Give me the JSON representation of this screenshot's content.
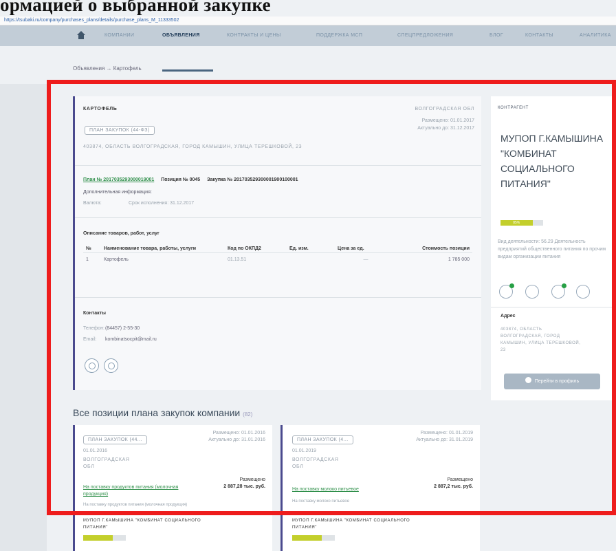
{
  "overlay": {
    "title": "ормацией о выбранной закупке"
  },
  "browser": {
    "url": "https://tsubaki.ru/company/purchases_plans/details/purchase_plans_M_11333502"
  },
  "nav": {
    "items": [
      "КОМПАНИИ",
      "ОБЪЯВЛЕНИЯ",
      "КОНТРАКТЫ И ЦЕНЫ",
      "ПОДДЕРЖКА МСП",
      "СПЕЦПРЕДЛОЖЕНИЯ",
      "БЛОГ",
      "КОНТАКТЫ",
      "АНАЛИТИКА"
    ],
    "active": "ОБЪЯВЛЕНИЯ"
  },
  "breadcrumb": {
    "text": "Объявления → Картофель"
  },
  "announcement": {
    "title": "КАРТОФЕЛЬ",
    "region": "ВОЛГОГРАДСКАЯ ОБЛ",
    "tag": "ПЛАН ЗАКУПОК (44-ФЗ)",
    "placed": "Размещено: 01.01.2017",
    "actual": "Актуально до: 31.12.2017",
    "address": "403874, ОБЛАСТЬ ВОЛГОГРАДСКАЯ, ГОРОД КАМЫШИН, УЛИЦА ТЕРЕШКОВОЙ, 23",
    "plan_link": "План № 2017035293000019001",
    "position": "Позиция № 0045",
    "purchase": "Закупка № 201703529300001900100001",
    "extra_info": "Дополнительная информация:",
    "currency_label": "Валюта:",
    "deadline": "Срок исполнения: 31.12.2017",
    "goods_title": "Описание товаров, работ, услуг",
    "table": {
      "headers": [
        "№",
        "Наименование товара, работы, услуги",
        "Код по ОКПД2",
        "Ед. изм.",
        "Цена за ед.",
        "Стоимость позиции"
      ],
      "rows": [
        [
          "1",
          "Картофель",
          "01.13.51",
          "",
          "—",
          "1 785 000"
        ]
      ]
    },
    "contacts_title": "Контакты",
    "phone_label": "Телефон:",
    "phone": "(84457) 2-55-30",
    "email_label": "Email:",
    "email": "kombinatsocpit@mail.ru"
  },
  "sidebar": {
    "header": "КОНТРАГЕНТ",
    "company": "МУПОП Г.КАМЫШИНА \"КОМБИНАТ СОЦИАЛЬНОГО ПИТАНИЯ\"",
    "rating": 0.75,
    "rating_label": "85%",
    "activity": "Вид деятельности: 56.29 Деятельность предприятий общественного питания по прочим видам организации питания",
    "address_title": "Адрес",
    "address": "403874, ОБЛАСТЬ ВОЛГОГРАДСКАЯ, ГОРОД КАМЫШИН, УЛИЦА ТЕРЕШКОВОЙ, 23",
    "profile_button": "Перейти в профиль",
    "icons": [
      "phone-icon",
      "eye-icon",
      "handshake-icon",
      "list-icon"
    ]
  },
  "positions": {
    "title": "Все позиции плана закупок компании",
    "count": "(82)",
    "cards": [
      {
        "tag": "ПЛАН ЗАКУПОК (44...",
        "placed": "Размещено: 01.01.2016",
        "actual": "Актуально до: 31.01.2016",
        "date": "01.01.2016",
        "region": "ВОЛГОГРАДСКАЯ ОБЛ",
        "status": "Размещено",
        "amount": "2 887,28 тыс. руб.",
        "link": "На поставку продуктов питания (молочная продукция)",
        "desc": "На поставку продуктов питания (молочная продукция)",
        "company": "МУПОП Г.КАМЫШИНА \"КОМБИНАТ СОЦИАЛЬНОГО ПИТАНИЯ\"",
        "rating": 0.7
      },
      {
        "tag": "ПЛАН ЗАКУПОК (4...",
        "placed": "Размещено: 01.01.2019",
        "actual": "Актуально до: 31.01.2019",
        "date": "01.01.2019",
        "region": "ВОЛГОГРАДСКАЯ ОБЛ",
        "status": "Размещено",
        "amount": "2 887,2 тыс. руб.",
        "link": "На поставку молоко питьевое",
        "desc": "На поставку молоко питьевое",
        "company": "МУПОП Г.КАМЫШИНА \"КОМБИНАТ СОЦИАЛЬНОГО ПИТАНИЯ\"",
        "rating": 0.7
      }
    ]
  },
  "colors": {
    "accent": "#4a4a8e",
    "green": "#2f8f4a",
    "highlight": "#ee1c1c",
    "rating": "#c3cf2c"
  }
}
